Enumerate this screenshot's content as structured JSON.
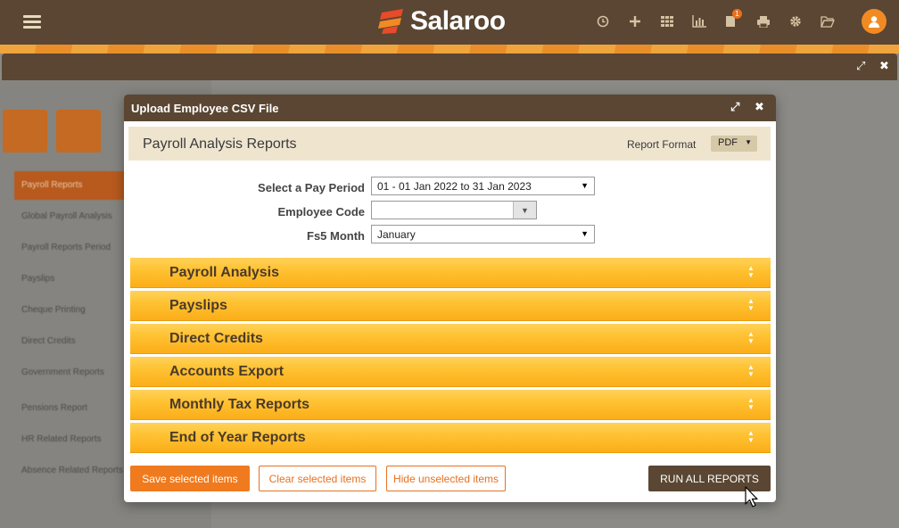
{
  "app": {
    "name": "Salaroo"
  },
  "topbar": {
    "icons": [
      "clock-icon",
      "plus-icon",
      "grid-icon",
      "bar-chart-icon",
      "notifications-icon",
      "print-icon",
      "gear-icon",
      "folder-open-icon"
    ],
    "notification_count": "1"
  },
  "background": {
    "sidebar_items": [
      "Payroll Reports",
      "Global Payroll Analysis",
      "Payroll Reports Period",
      "Payslips",
      "Cheque Printing",
      "Direct Credits",
      "Government Reports",
      "Pensions Report",
      "HR Related Reports",
      "Absence Related Reports"
    ]
  },
  "modal": {
    "title": "Upload Employee CSV File",
    "section_title": "Payroll Analysis Reports",
    "report_format_label": "Report Format",
    "report_format_value": "PDF",
    "fields": {
      "pay_period_label": "Select a Pay Period",
      "pay_period_value": "01 - 01 Jan 2022  to  31 Jan 2023",
      "employee_code_label": "Employee Code",
      "employee_code_value": "",
      "fs5_month_label": "Fs5 Month",
      "fs5_month_value": "January"
    },
    "categories": [
      "Payroll Analysis",
      "Payslips",
      "Direct Credits",
      "Accounts Export",
      "Monthly Tax Reports",
      "End of Year Reports"
    ],
    "buttons": {
      "save": "Save selected items",
      "clear": "Clear selected items",
      "hide": "Hide unselected items",
      "run_all": "RUN ALL REPORTS"
    }
  },
  "colors": {
    "brand_brown": "#5a4632",
    "accent_orange": "#f07a1e",
    "category_yellow": "#ffc233"
  }
}
